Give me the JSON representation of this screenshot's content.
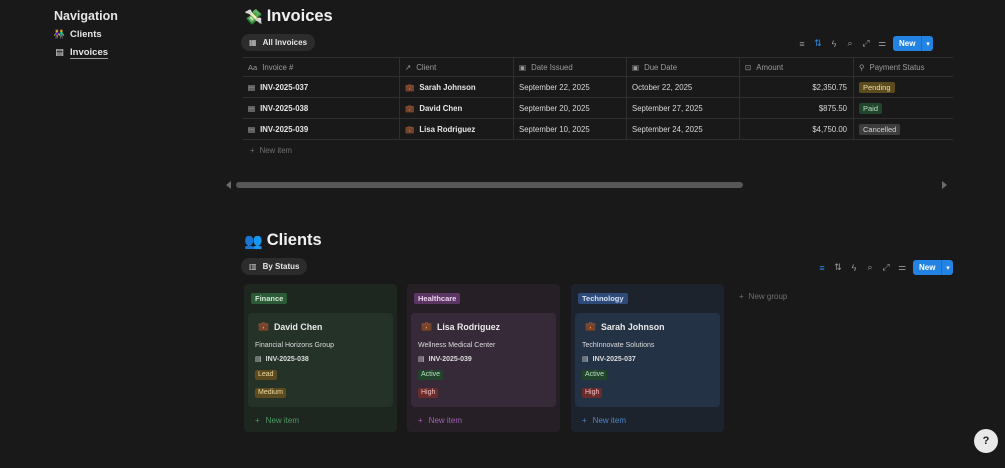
{
  "nav": {
    "title": "Navigation",
    "items": [
      {
        "label": "Clients",
        "icon": "people-icon"
      },
      {
        "label": "Invoices",
        "icon": "receipt-icon"
      }
    ]
  },
  "invoices": {
    "emoji": "💸",
    "title": "Invoices",
    "view_label": "All Invoices",
    "new_label": "New",
    "columns": [
      "Invoice #",
      "Client",
      "Date Issued",
      "Due Date",
      "Amount",
      "Payment Status"
    ],
    "rows": [
      {
        "invoice": "INV-2025-037",
        "client": "Sarah Johnson",
        "issued": "September 22, 2025",
        "due": "October 22, 2025",
        "amount": "$2,350.75",
        "status": "Pending"
      },
      {
        "invoice": "INV-2025-038",
        "client": "David Chen",
        "issued": "September 20, 2025",
        "due": "September 27, 2025",
        "amount": "$875.50",
        "status": "Paid"
      },
      {
        "invoice": "INV-2025-039",
        "client": "Lisa Rodriguez",
        "issued": "September 10, 2025",
        "due": "September 24, 2025",
        "amount": "$4,750.00",
        "status": "Cancelled"
      }
    ],
    "new_item": "New item"
  },
  "clients": {
    "emoji": "👥",
    "title": "Clients",
    "view_label": "By Status",
    "new_label": "New",
    "new_group": "New group",
    "groups": [
      {
        "name": "Finance",
        "card": {
          "name": "David Chen",
          "org": "Financial Horizons Group",
          "invoice": "INV-2025-038",
          "status": "Lead",
          "priority": "Medium"
        },
        "new_item": "New item"
      },
      {
        "name": "Healthcare",
        "card": {
          "name": "Lisa Rodriguez",
          "org": "Wellness Medical Center",
          "invoice": "INV-2025-039",
          "status": "Active",
          "priority": "High"
        },
        "new_item": "New item"
      },
      {
        "name": "Technology",
        "card": {
          "name": "Sarah Johnson",
          "org": "TechInnovate Solutions",
          "invoice": "INV-2025-037",
          "status": "Active",
          "priority": "High"
        },
        "new_item": "New item"
      }
    ]
  },
  "help": {
    "label": "?"
  },
  "colors": {
    "accent": "#2383e2",
    "background": "#191919"
  }
}
